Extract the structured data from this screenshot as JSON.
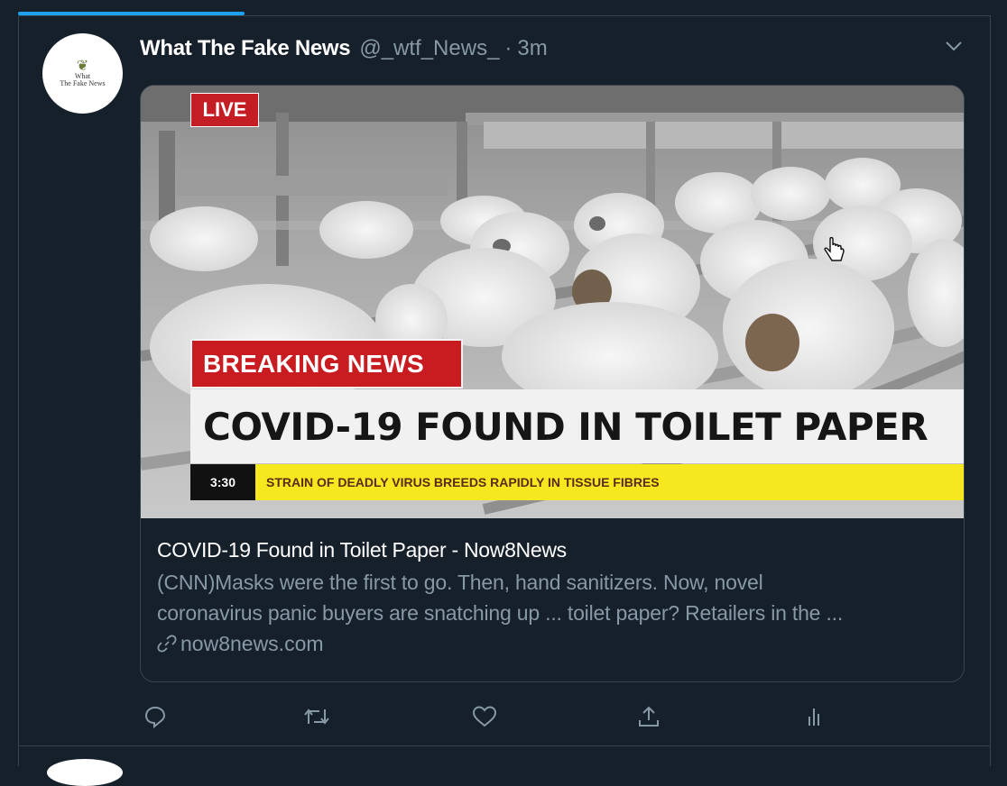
{
  "tweet": {
    "author_name": "What The Fake News",
    "author_handle": "@_wtf_News_",
    "separator": "·",
    "timestamp": "3m",
    "avatar_logo": {
      "line1": "What",
      "line2": "The Fake News"
    },
    "media": {
      "live_label": "LIVE",
      "breaking_label": "BREAKING NEWS",
      "headline": "COVID-19 FOUND IN TOILET PAPER",
      "clock": "3:30",
      "ticker": "STRAIN OF DEADLY VIRUS BREEDS RAPIDLY IN TISSUE FIBRES"
    },
    "link_card": {
      "title": "COVID-19 Found in Toilet Paper - Now8News",
      "description": "(CNN)Masks were the first to go. Then, hand sanitizers. Now, novel coronavirus panic buyers are snatching up ... toilet paper? Retailers in the ...",
      "description_line1": "(CNN)Masks were the first to go. Then, hand sanitizers. Now, novel",
      "description_line2": "coronavirus panic buyers are snatching up ... toilet paper? Retailers in the ...",
      "domain": "now8news.com"
    },
    "actions": [
      "reply-icon",
      "retweet-icon",
      "like-icon",
      "share-icon",
      "analytics-icon"
    ]
  },
  "colors": {
    "background": "#15202b",
    "divider": "#38444d",
    "secondary_text": "#8899a6",
    "accent": "#1da1f2",
    "live_red": "#c41e24",
    "ticker_yellow": "#f5e81f"
  }
}
